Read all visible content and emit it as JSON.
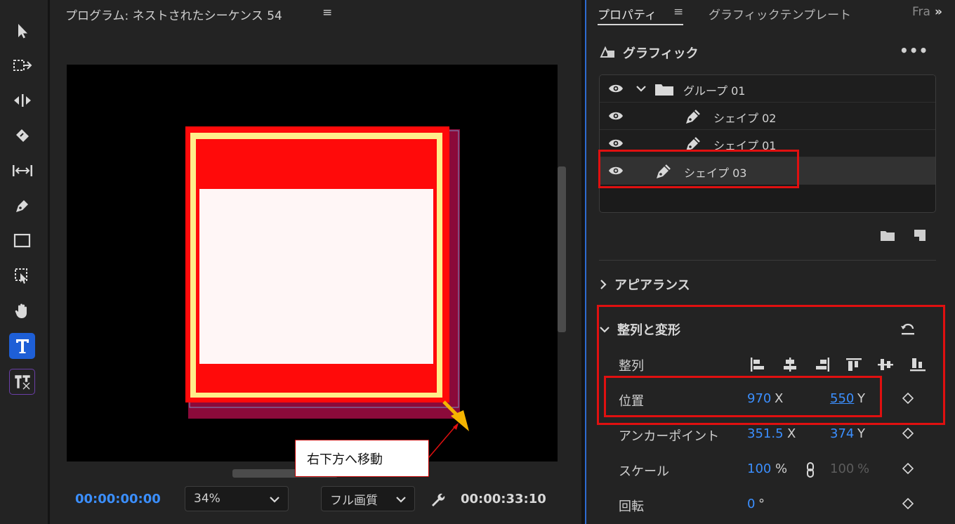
{
  "colors": {
    "accent_blue": "#3b8fff",
    "active_tool": "#1e5fd6",
    "annotation_red": "#e01010",
    "shape_red": "#ff0a0a",
    "shape_yellow": "#ffee8a",
    "shape_white": "#fff6f6",
    "shape_maroon": "#8b0a3a",
    "arrow_yellow": "#f5b400"
  },
  "toolbar": {
    "tools": [
      {
        "name": "selection-tool",
        "icon": "arrow-pointer-icon"
      },
      {
        "name": "track-select-tool",
        "icon": "track-select-icon"
      },
      {
        "name": "ripple-edit-tool",
        "icon": "ripple-edit-icon"
      },
      {
        "name": "razor-tool",
        "icon": "razor-icon"
      },
      {
        "name": "slip-tool",
        "icon": "slip-icon"
      },
      {
        "name": "pen-tool",
        "icon": "pen-icon"
      },
      {
        "name": "rectangle-tool",
        "icon": "rectangle-icon"
      },
      {
        "name": "transform-tool",
        "icon": "transform-icon"
      },
      {
        "name": "hand-tool",
        "icon": "hand-icon"
      },
      {
        "name": "type-tool",
        "icon": "type-icon",
        "active": true
      },
      {
        "name": "vertical-type-tool",
        "icon": "vertical-type-icon"
      }
    ]
  },
  "monitor": {
    "title": "プログラム: ネストされたシーケンス 54",
    "menu_glyph": "≡",
    "timecode_current": "00:00:00:00",
    "zoom": "34%",
    "quality": "フル画質",
    "timecode_duration": "00:00:33:10"
  },
  "panel": {
    "tabs": {
      "properties": "プロパティ",
      "menu_glyph": "≡",
      "graphic_template": "グラフィックテンプレート",
      "truncated": "Fra",
      "more": "»"
    },
    "graphic": {
      "title": "グラフィック",
      "more": "•••",
      "layers": [
        {
          "label": "グループ 01",
          "type": "group",
          "visible": true
        },
        {
          "label": "シェイプ 02",
          "type": "shape",
          "visible": true
        },
        {
          "label": "シェイプ 01",
          "type": "shape",
          "visible": true
        },
        {
          "label": "シェイプ 03",
          "type": "shape",
          "visible": true,
          "selected": true
        }
      ]
    },
    "appearance": {
      "title": "アピアランス"
    },
    "transform": {
      "title": "整列と変形",
      "align_label": "整列",
      "position": {
        "label": "位置",
        "x": "970",
        "x_unit": "X",
        "y": "550",
        "y_unit": "Y"
      },
      "anchor": {
        "label": "アンカーポイント",
        "x": "351.5",
        "x_unit": "X",
        "y": "374",
        "y_unit": "Y"
      },
      "scale": {
        "label": "スケール",
        "value": "100",
        "unit": "%",
        "value2": "100",
        "unit2": "%"
      },
      "rotation": {
        "label": "回転",
        "value": "0",
        "unit": "°"
      }
    }
  },
  "annotation": {
    "callout": "右下方へ移動"
  }
}
